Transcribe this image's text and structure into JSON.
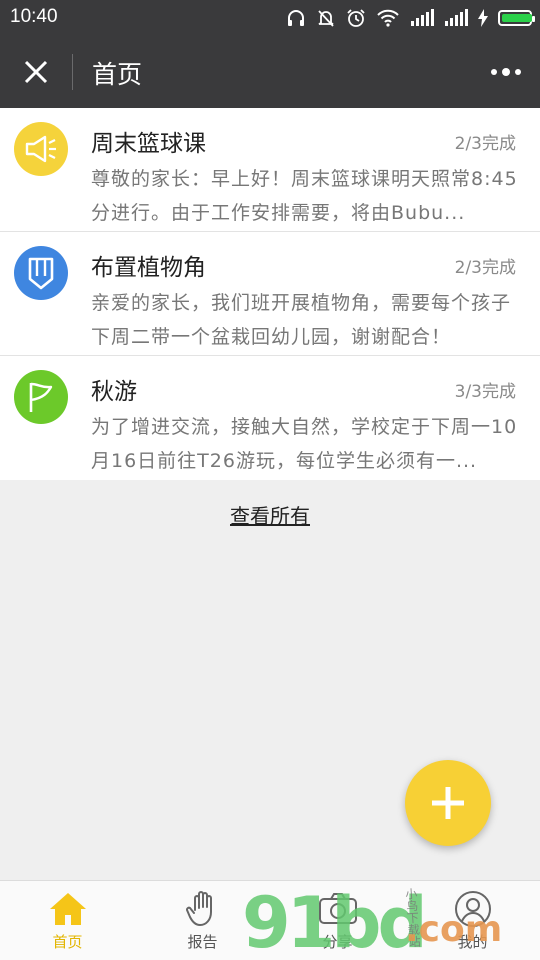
{
  "statusbar": {
    "time": "10:40",
    "icons": [
      "headphones-icon",
      "mute-bell-icon",
      "alarm-icon",
      "wifi-icon",
      "signal-icon",
      "signal-icon",
      "charging-icon",
      "battery-icon"
    ]
  },
  "header": {
    "title": "首页",
    "close_icon": "close-icon",
    "more_icon": "more-icon"
  },
  "items": [
    {
      "name": "周末篮球课",
      "status": "2/3完成",
      "desc": "尊敬的家长：早上好！周末篮球课明天照常8:45分进行。由于工作安排需要，将由Bubu...",
      "icon": "megaphone-icon",
      "color": "#f5d33b"
    },
    {
      "name": "布置植物角",
      "status": "2/3完成",
      "desc": "亲爱的家长，我们班开展植物角，需要每个孩子下周二带一个盆栽回幼儿园，谢谢配合！",
      "icon": "pencil-icon",
      "color": "#3f86e0"
    },
    {
      "name": "秋游",
      "status": "3/3完成",
      "desc": "为了增进交流，接触大自然，学校定于下周一10月16日前往T26游玩，每位学生必须有一...",
      "icon": "flag-icon",
      "color": "#6cc92a"
    }
  ],
  "view_all": "查看所有",
  "fab_icon": "plus-icon",
  "accent": "#f7d035",
  "tabs": [
    {
      "label": "首页",
      "icon": "home-icon",
      "active": true
    },
    {
      "label": "报告",
      "icon": "hand-icon",
      "active": false
    },
    {
      "label": "分享",
      "icon": "camera-icon",
      "active": false
    },
    {
      "label": "我的",
      "icon": "user-icon",
      "active": false
    }
  ],
  "watermark": {
    "main": "91bd",
    "domain": ".com",
    "tag": "小鸟下载站"
  }
}
